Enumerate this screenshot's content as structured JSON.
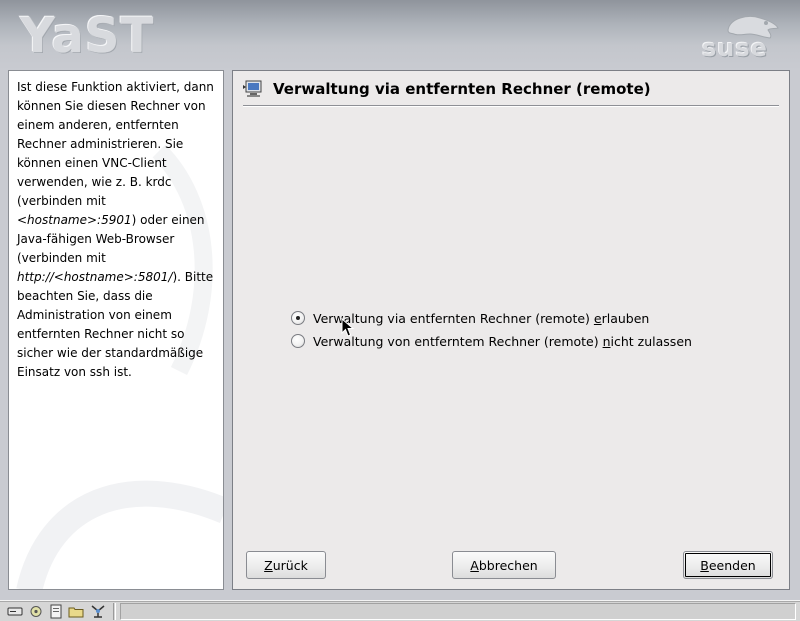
{
  "header": {
    "logo_text": "YaST",
    "brand_text": "suse"
  },
  "help": {
    "paragraph": [
      {
        "text": "Ist diese Funktion aktiviert, dann können Sie diesen Rechner von einem anderen, entfernten Rechner administrieren. Sie können einen VNC-Client verwenden, wie z. B. krdc (verbinden mit ",
        "italic": false
      },
      {
        "text": "<hostname>:5901",
        "italic": true
      },
      {
        "text": ") oder einen Java-fähigen Web-Browser (verbinden mit ",
        "italic": false
      },
      {
        "text": "http://<hostname>:5801/",
        "italic": true
      },
      {
        "text": "). Bitte beachten Sie, dass die Administration von einem entfernten Rechner nicht so sicher wie der standardmäßige Einsatz von ssh ist.",
        "italic": false
      }
    ]
  },
  "content": {
    "title": "Verwaltung via entfernten Rechner (remote)",
    "options": [
      {
        "label_before": "Verwaltung via entfernten Rechner (remote) ",
        "mnemonic": "e",
        "label_after": "rlauben",
        "checked": true
      },
      {
        "label_before": "Verwaltung von entferntem Rechner (remote) ",
        "mnemonic": "n",
        "label_after": "icht zulassen",
        "checked": false
      }
    ]
  },
  "buttons": {
    "back": {
      "mnemonic": "Z",
      "rest": "urück"
    },
    "abort": {
      "mnemonic": "A",
      "rest": "bbrechen"
    },
    "finish": {
      "mnemonic": "B",
      "rest": "eenden"
    }
  },
  "taskbar": {
    "icons": [
      "drive-icon",
      "gear-icon",
      "document-icon",
      "folder-icon",
      "network-icon"
    ]
  },
  "colors": {
    "panel_background": "#eceaea",
    "help_background": "#ffffff",
    "desktop_background": "#c9cbd1"
  }
}
